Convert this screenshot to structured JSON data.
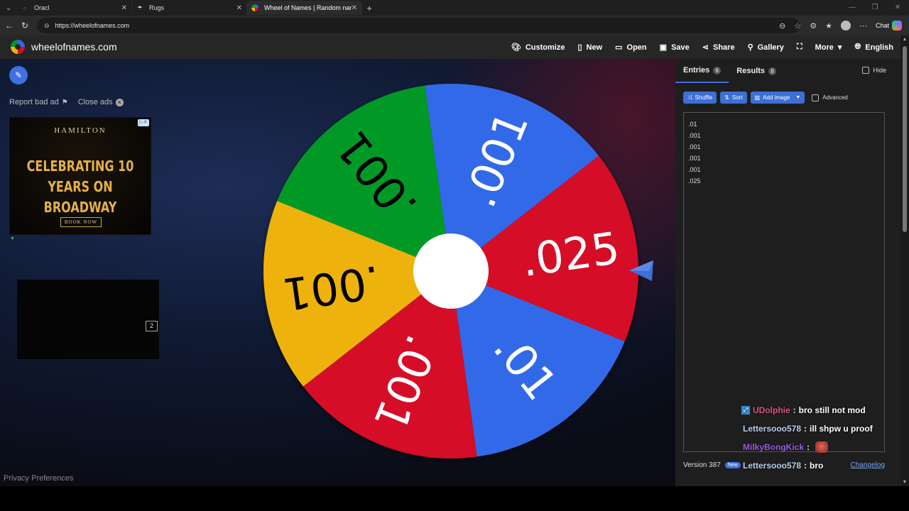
{
  "browser": {
    "tabs": [
      {
        "title": "Oracl",
        "icon": "oracle-icon"
      },
      {
        "title": "Rugs",
        "icon": "rugs-icon"
      },
      {
        "title": "Wheel of Names | Random name",
        "icon": "wheel-icon"
      }
    ],
    "url": "https://wheelofnames.com",
    "chat_label": "Chat"
  },
  "header": {
    "site_name": "wheelofnames.com",
    "menu": {
      "customize": "Customize",
      "new": "New",
      "open": "Open",
      "save": "Save",
      "share": "Share",
      "gallery": "Gallery",
      "more": "More",
      "language": "English"
    }
  },
  "left": {
    "report_ad": "Report bad ad",
    "close_ads": "Close ads",
    "ad": {
      "brand": "HAMILTON",
      "headline_1": "CELEBRATING 10",
      "headline_2": "YEARS ON BROADWAY",
      "cta": "BOOK NOW"
    },
    "ad2_page": "2",
    "privacy": "Privacy Preferences"
  },
  "wheel": {
    "colors": {
      "blue": "#3369e8",
      "red": "#d50f25",
      "yellow": "#eeb211",
      "green": "#009925"
    },
    "segments": [
      {
        "label": ".01",
        "color": "#3369e8"
      },
      {
        "label": ".001",
        "color": "#d50f25"
      },
      {
        "label": ".001",
        "color": "#eeb211"
      },
      {
        "label": ".001",
        "color": "#009925"
      },
      {
        "label": ".001",
        "color": "#3369e8"
      },
      {
        "label": ".025",
        "color": "#d50f25"
      }
    ]
  },
  "panel": {
    "tab_entries": "Entries",
    "entries_count": "6",
    "tab_results": "Results",
    "results_count": "8",
    "hide": "Hide",
    "shuffle": "Shuffle",
    "sort": "Sort",
    "add_image": "Add image",
    "advanced": "Advanced",
    "entries": [
      ".01",
      ".001",
      ".001",
      ".001",
      ".001",
      ".025"
    ],
    "version": "Version 387",
    "new_badge": "New",
    "changelog": "Changelog"
  },
  "chat": [
    {
      "user": "UDolphie",
      "color": "#e0557e",
      "text": "bro still not mod"
    },
    {
      "user": "Lettersooo578",
      "color": "#b9d3ec",
      "text": "ill shpw u proof"
    },
    {
      "user": "MilkyBongKick",
      "color": "#9b5de5",
      "text": ""
    },
    {
      "user": "Lettersooo578",
      "color": "#b9d3ec",
      "text": "bro"
    }
  ]
}
